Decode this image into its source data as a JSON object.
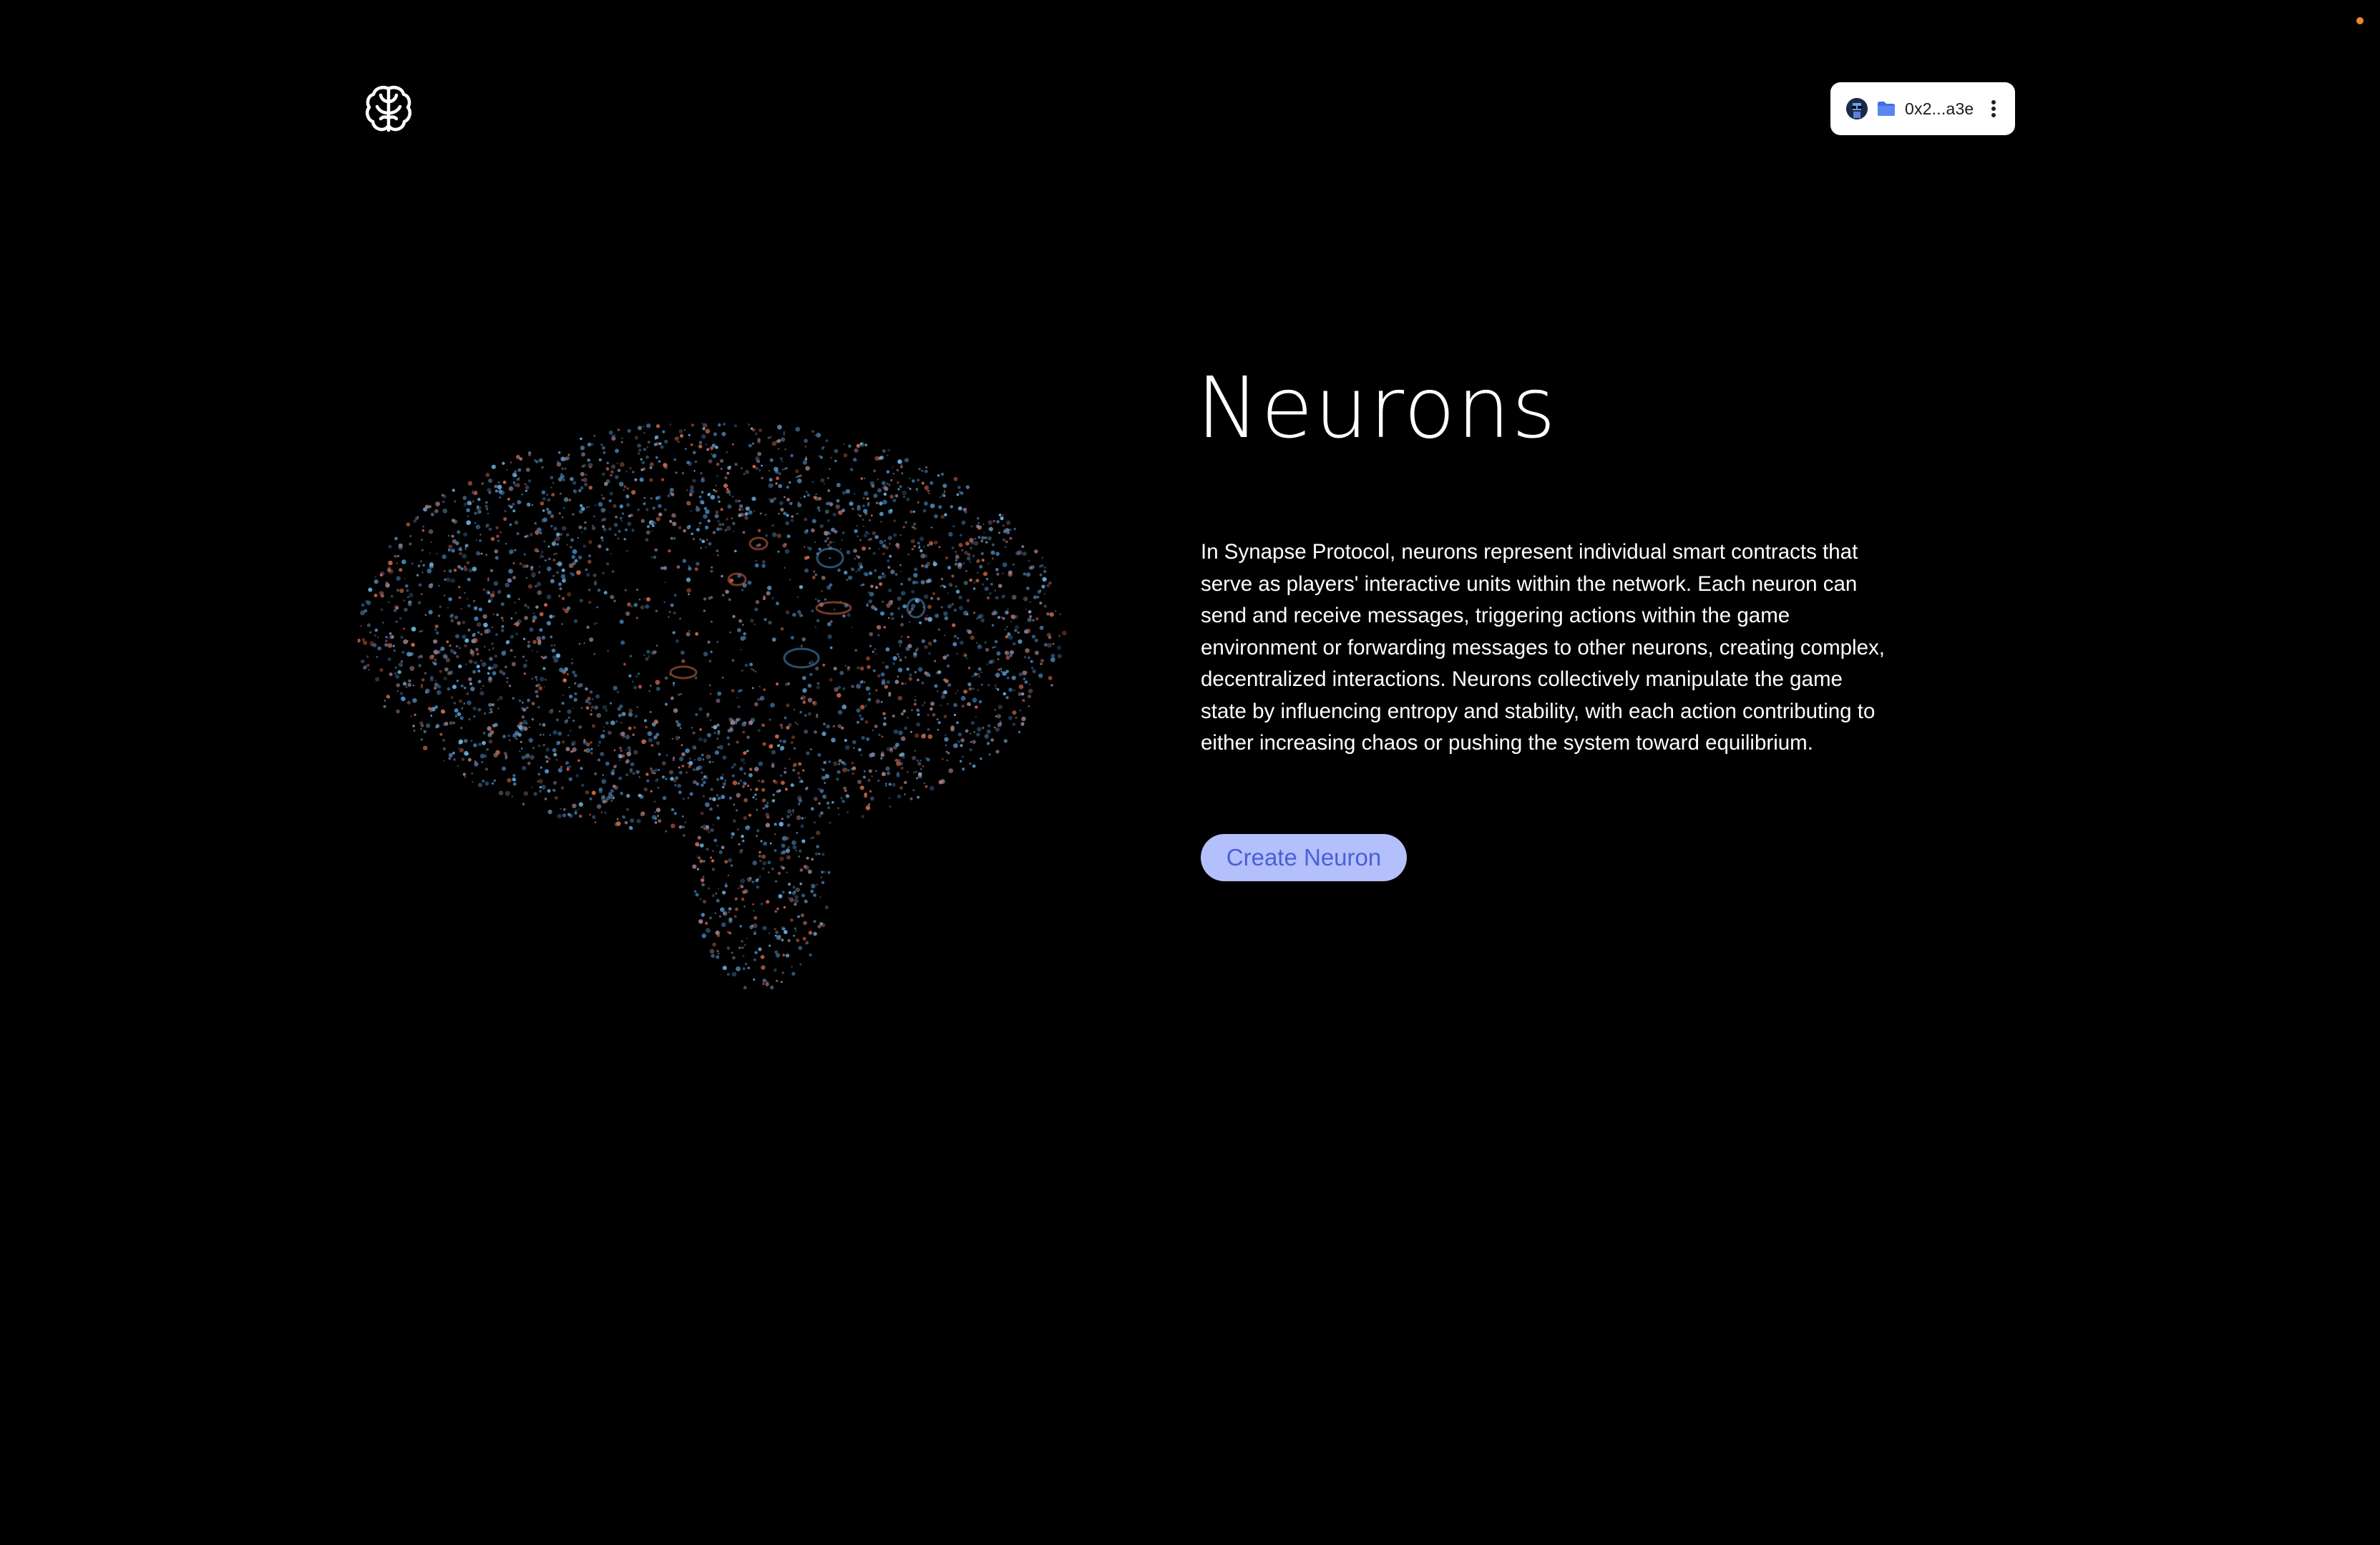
{
  "header": {
    "logo_icon": "brain-outline-icon",
    "wallet": {
      "avatar_icon": "nouns-avatar-icon",
      "chain_icon": "wallet-folder-icon",
      "address": "0x2...a3e",
      "menu_icon": "more-vertical-icon"
    }
  },
  "hero": {
    "visual": "brain-particle-icon",
    "title": "Neurons",
    "description": "In Synapse Protocol, neurons represent individual smart contracts that serve as players' interactive units within the network. Each neuron can send and receive messages, triggering actions within the game environment or forwarding messages to other neurons, creating complex, decentralized interactions. Neurons collectively manipulate the game state by influencing entropy and stability, with each action contributing to either increasing chaos or pushing the system toward equilibrium.",
    "cta_label": "Create Neuron"
  },
  "colors": {
    "background": "#000000",
    "text": "#ffffff",
    "cta_background": "#b4c0fb",
    "cta_text": "#4b5fd6",
    "particle_blue": "#4f8fc9",
    "particle_orange": "#d0684a",
    "status_dot": "#e8892b"
  }
}
